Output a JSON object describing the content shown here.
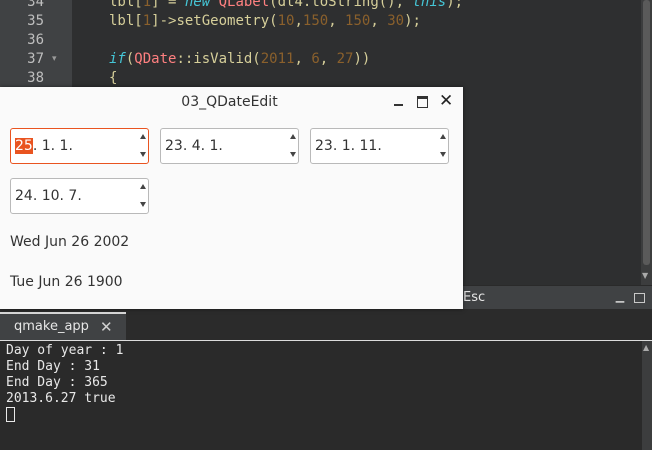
{
  "editor": {
    "lines": [
      {
        "num": "34",
        "fold": "",
        "code": [
          {
            "t": "lbl[",
            "c": "plain"
          },
          {
            "t": "1",
            "c": "num"
          },
          {
            "t": "] = ",
            "c": "plain"
          },
          {
            "t": "new ",
            "c": "kw"
          },
          {
            "t": "QLabel",
            "c": "ty"
          },
          {
            "t": "(dt4.toString(), ",
            "c": "plain"
          },
          {
            "t": "this",
            "c": "kw"
          },
          {
            "t": ");",
            "c": "plain"
          }
        ]
      },
      {
        "num": "35",
        "fold": "",
        "code": [
          {
            "t": "lbl[",
            "c": "plain"
          },
          {
            "t": "1",
            "c": "num"
          },
          {
            "t": "]->setGeometry(",
            "c": "plain"
          },
          {
            "t": "10",
            "c": "num"
          },
          {
            "t": ",",
            "c": "plain"
          },
          {
            "t": "150",
            "c": "num"
          },
          {
            "t": ", ",
            "c": "plain"
          },
          {
            "t": "150",
            "c": "num"
          },
          {
            "t": ", ",
            "c": "plain"
          },
          {
            "t": "30",
            "c": "num"
          },
          {
            "t": ");",
            "c": "plain"
          }
        ]
      },
      {
        "num": "36",
        "fold": "",
        "code": []
      },
      {
        "num": "37",
        "fold": "▾",
        "code": [
          {
            "t": "if",
            "c": "kw"
          },
          {
            "t": "(",
            "c": "plain"
          },
          {
            "t": "QDate",
            "c": "ty"
          },
          {
            "t": "::isValid(",
            "c": "plain"
          },
          {
            "t": "2011",
            "c": "num"
          },
          {
            "t": ", ",
            "c": "plain"
          },
          {
            "t": "6",
            "c": "num"
          },
          {
            "t": ", ",
            "c": "plain"
          },
          {
            "t": "27",
            "c": "num"
          },
          {
            "t": "))",
            "c": "plain"
          }
        ]
      },
      {
        "num": "38",
        "fold": "",
        "code": [
          {
            "t": "{",
            "c": "plain"
          }
        ]
      }
    ]
  },
  "output_bar": {
    "esc_label": "Esc"
  },
  "output_tabs": [
    {
      "label": "qmake_app"
    }
  ],
  "console": {
    "lines": [
      "Day of year : 1",
      "End Day : 31",
      "End Day : 365",
      "2013.6.27 true"
    ]
  },
  "window": {
    "title": "03_QDateEdit",
    "date_edits": [
      {
        "selected": "25",
        "rest": ". 1. 1."
      },
      {
        "selected": "",
        "rest": "23. 4. 1."
      },
      {
        "selected": "",
        "rest": "23. 1. 11."
      },
      {
        "selected": "",
        "rest": "24. 10. 7."
      }
    ],
    "labels": [
      "Wed Jun 26 2002",
      "Tue Jun 26 1900"
    ]
  }
}
